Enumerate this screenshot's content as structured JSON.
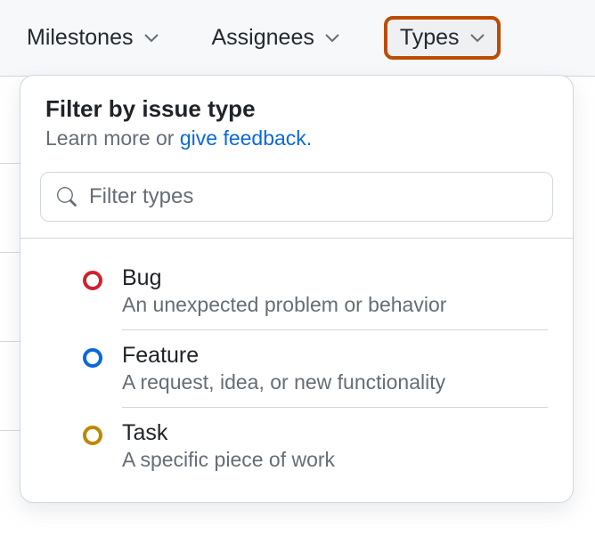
{
  "toolbar": {
    "filters": [
      {
        "label": "Milestones"
      },
      {
        "label": "Assignees"
      },
      {
        "label": "Types"
      }
    ]
  },
  "dropdown": {
    "title": "Filter by issue type",
    "subtext_prefix": "Learn more or ",
    "subtext_link": "give feedback.",
    "search_placeholder": "Filter types",
    "types": [
      {
        "name": "Bug",
        "description": "An unexpected problem or behavior",
        "color": "#cf222e"
      },
      {
        "name": "Feature",
        "description": "A request, idea, or new functionality",
        "color": "#0969da"
      },
      {
        "name": "Task",
        "description": "A specific piece of work",
        "color": "#bf8700"
      }
    ]
  }
}
